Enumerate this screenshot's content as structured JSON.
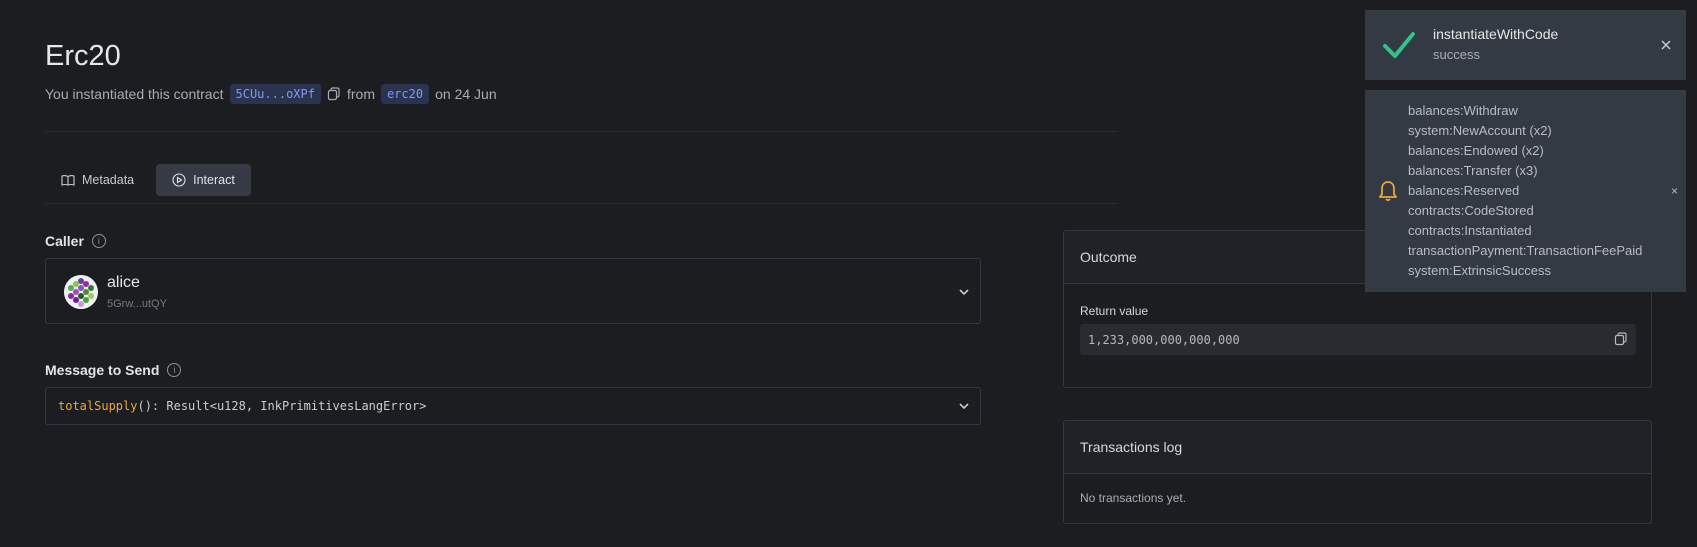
{
  "header": {
    "title": "Erc20",
    "prefix": "You instantiated this contract",
    "address": "5CUu...oXPf",
    "from_label": "from",
    "code_name": "erc20",
    "date_text": "on 24 Jun"
  },
  "tabs": [
    {
      "label": "Metadata",
      "icon": "book-icon"
    },
    {
      "label": "Interact",
      "icon": "play-circle-icon",
      "active": true
    }
  ],
  "caller": {
    "label": "Caller",
    "name": "alice",
    "address": "5Grw...utQY"
  },
  "message": {
    "label": "Message to Send",
    "fn": "totalSupply",
    "signature": "(): Result<u128, InkPrimitivesLangError>"
  },
  "outcome": {
    "title": "Outcome",
    "return_label": "Return value",
    "return_value": "1,233,000,000,000,000"
  },
  "transactions": {
    "title": "Transactions log",
    "empty": "No transactions yet."
  },
  "toasts": {
    "success": {
      "title": "instantiateWithCode",
      "status": "success"
    },
    "events": [
      "balances:Withdraw",
      "system:NewAccount (x2)",
      "balances:Endowed (x2)",
      "balances:Transfer (x3)",
      "balances:Reserved",
      "contracts:CodeStored",
      "contracts:Instantiated",
      "transactionPayment:TransactionFeePaid",
      "system:ExtrinsicSuccess"
    ],
    "close_glyph": "×"
  },
  "colors": {
    "background": "#1c1d21",
    "accent_chip": "#7f9cf5",
    "success": "#2fc48d",
    "bell": "#f0a63a",
    "function_name": "#f0a63a"
  }
}
